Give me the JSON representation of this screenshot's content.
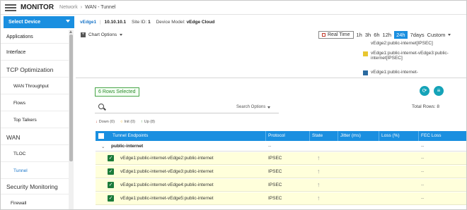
{
  "header": {
    "title": "MONITOR",
    "breadcrumb_parent": "Network",
    "breadcrumb_separator": "›",
    "breadcrumb_current": "WAN - Tunnel"
  },
  "device": {
    "select_label": "Select Device",
    "name": "vEdge1",
    "ip": "10.10.10.1",
    "site_id_label": "Site ID:",
    "site_id": "1",
    "model_label": "Device Model:",
    "model": "vEdge Cloud"
  },
  "sidebar": {
    "items": [
      {
        "label": "Applications"
      },
      {
        "label": "Interface"
      },
      {
        "label": "TCP Optimization"
      },
      {
        "label": "WAN Throughput"
      },
      {
        "label": "Flows"
      },
      {
        "label": "Top Talkers"
      },
      {
        "label": "WAN"
      },
      {
        "label": "TLOC"
      },
      {
        "label": "Tunnel"
      },
      {
        "label": "Security Monitoring"
      },
      {
        "label": "Firewall"
      }
    ]
  },
  "chart_controls": {
    "options_label": "Chart Options",
    "realtime_label": "Real Time",
    "time_ranges": [
      "1h",
      "3h",
      "6h",
      "12h",
      "24h",
      "7days",
      "Custom"
    ],
    "selected_range": "24h"
  },
  "legend": {
    "items": [
      {
        "label": "vEdge2:public-internet[IPSEC]",
        "color": "#ffffff"
      },
      {
        "label": "vEdge1:public-internet-vEdge3:public-internet[IPSEC]",
        "color": "#e8c630"
      },
      {
        "label": "vEdge1:public-internet-",
        "color": "#2a6aa0"
      }
    ]
  },
  "selection": {
    "rows_selected": "6 Rows Selected",
    "total_rows": "Total Rows: 8"
  },
  "search": {
    "options_label": "Search Options"
  },
  "status_filter": {
    "down": "Down (0)",
    "init": "Init (0)",
    "up": "Up (8)"
  },
  "table": {
    "columns": [
      "Tunnel Endpoints",
      "Protocol",
      "State",
      "Jitter (ms)",
      "Loss (%)",
      "FEC Loss"
    ],
    "group": {
      "name": "public-internet",
      "protocol": "--",
      "fec": "--"
    },
    "rows": [
      {
        "endpoint": "vEdge1:public-internet-vEdge2:public-internet",
        "protocol": "IPSEC",
        "state": "↑",
        "fec": "--"
      },
      {
        "endpoint": "vEdge1:public-internet-vEdge3:public-internet",
        "protocol": "IPSEC",
        "state": "↑",
        "fec": "--"
      },
      {
        "endpoint": "vEdge1:public-internet-vEdge4:public-internet",
        "protocol": "IPSEC",
        "state": "↑",
        "fec": "--"
      },
      {
        "endpoint": "vEdge1:public-internet-vEdge5:public-internet",
        "protocol": "IPSEC",
        "state": "↑",
        "fec": "--"
      }
    ]
  },
  "colors": {
    "accent": "#1a8fe0",
    "selected_row": "#ffffdb",
    "checkbox": "#1b7b3a",
    "action_button": "#15a3b8"
  },
  "icons": [
    "menu-icon",
    "chevron-down-icon",
    "search-icon",
    "refresh-icon",
    "list-icon",
    "arrow-up-icon",
    "arrow-down-icon"
  ]
}
